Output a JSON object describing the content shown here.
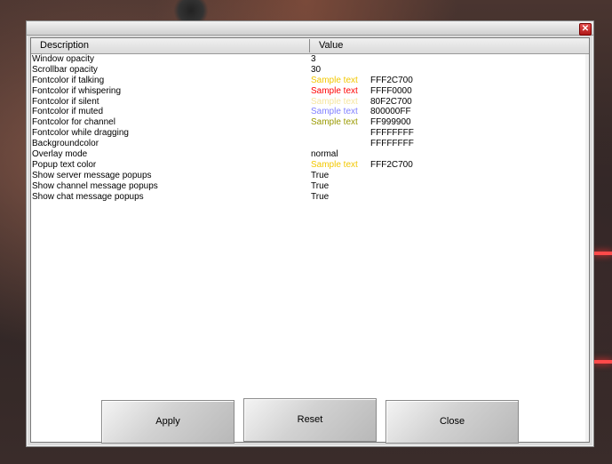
{
  "table": {
    "headers": {
      "description": "Description",
      "value": "Value"
    },
    "rows": [
      {
        "desc": "Window opacity",
        "value": "3"
      },
      {
        "desc": "Scrollbar opacity",
        "value": "30"
      },
      {
        "desc": "Fontcolor if talking",
        "sample": "Sample text",
        "sample_color": "#f2c700",
        "hex": "FFF2C700"
      },
      {
        "desc": "Fontcolor if whispering",
        "sample": "Sample text",
        "sample_color": "#ff0000",
        "hex": "FFFF0000"
      },
      {
        "desc": "Fontcolor if silent",
        "sample": "Sample text",
        "sample_color": "#f6e6a0",
        "hex": "80F2C700"
      },
      {
        "desc": "Fontcolor if muted",
        "sample": "Sample text",
        "sample_color": "#8080ff",
        "hex": "800000FF"
      },
      {
        "desc": "Fontcolor for channel",
        "sample": "Sample text",
        "sample_color": "#999900",
        "hex": "FF999900"
      },
      {
        "desc": "Fontcolor while dragging",
        "sample": "",
        "sample_color": "#ffffff",
        "hex": "FFFFFFFF"
      },
      {
        "desc": "Backgroundcolor",
        "sample": "",
        "sample_color": "#ffffff",
        "hex": "FFFFFFFF"
      },
      {
        "desc": "Overlay mode",
        "value": "normal"
      },
      {
        "desc": "Popup text color",
        "sample": "Sample text",
        "sample_color": "#f2c700",
        "hex": "FFF2C700"
      },
      {
        "desc": "Show server message popups",
        "value": "True"
      },
      {
        "desc": "Show channel message popups",
        "value": "True"
      },
      {
        "desc": "Show chat message popups",
        "value": "True"
      }
    ]
  },
  "buttons": {
    "apply": "Apply",
    "reset": "Reset",
    "close": "Close"
  },
  "window": {
    "close_icon": "close-icon",
    "close_glyph": "✕"
  }
}
